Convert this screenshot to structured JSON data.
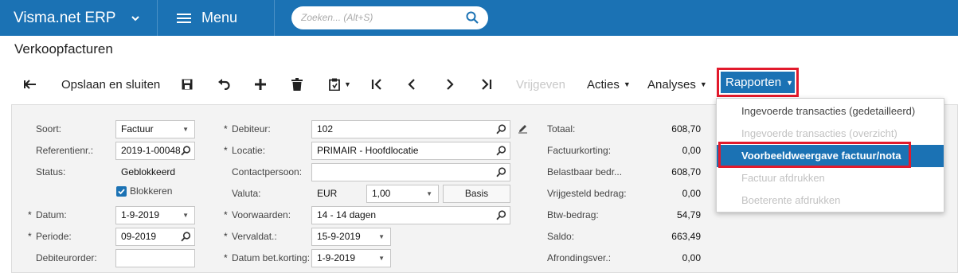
{
  "topbar": {
    "brand": "Visma.net ERP",
    "menu_label": "Menu",
    "search_placeholder": "Zoeken... (Alt+S)"
  },
  "page_title": "Verkoopfacturen",
  "toolbar": {
    "save_close": "Opslaan en sluiten",
    "release": "Vrijgeven",
    "actions": "Acties",
    "analyses": "Analyses",
    "reports": "Rapporten"
  },
  "reports_menu": [
    {
      "label": "Ingevoerde transacties (gedetailleerd)",
      "state": "enabled"
    },
    {
      "label": "Ingevoerde transacties (overzicht)",
      "state": "disabled"
    },
    {
      "label": "Voorbeeldweergave factuur/nota",
      "state": "active"
    },
    {
      "label": "Factuur afdrukken",
      "state": "disabled"
    },
    {
      "label": "Boeterente afdrukken",
      "state": "disabled"
    }
  ],
  "form": {
    "col1": {
      "type_label": "Soort:",
      "type_value": "Factuur",
      "ref_label": "Referentienr.:",
      "ref_value": "2019-1-00048",
      "status_label": "Status:",
      "status_value": "Geblokkeerd",
      "hold_label": "Blokkeren",
      "date_label": "Datum:",
      "date_value": "1-9-2019",
      "period_label": "Periode:",
      "period_value": "09-2019",
      "customer_order_label": "Debiteurorder:",
      "customer_order_value": ""
    },
    "col2": {
      "customer_label": "Debiteur:",
      "customer_value": "102",
      "location_label": "Locatie:",
      "location_value": "PRIMAIR - Hoofdlocatie",
      "contact_label": "Contactpersoon:",
      "contact_value": "",
      "currency_label": "Valuta:",
      "currency_value": "EUR",
      "rate_value": "1,00",
      "basis_label": "Basis",
      "terms_label": "Voorwaarden:",
      "terms_value": "14 - 14 dagen",
      "due_label": "Vervaldat.:",
      "due_value": "15-9-2019",
      "discount_date_label": "Datum bet.korting:",
      "discount_date_value": "1-9-2019"
    },
    "col3": {
      "total_label": "Totaal:",
      "total_value": "608,70",
      "discount_label": "Factuurkorting:",
      "discount_value": "0,00",
      "taxable_label": "Belastbaar bedr...",
      "taxable_value": "608,70",
      "exempt_label": "Vrijgesteld bedrag:",
      "exempt_value": "0,00",
      "vat_label": "Btw-bedrag:",
      "vat_value": "54,79",
      "balance_label": "Saldo:",
      "balance_value": "663,49",
      "rounding_label": "Afrondingsver.:",
      "rounding_value": "0,00"
    }
  },
  "colors": {
    "brand_blue": "#1b72b4",
    "highlight_red": "#e21a2c"
  },
  "icons": [
    "chevron-down-icon",
    "menu-icon",
    "search-icon",
    "back-arrow-icon",
    "save-icon",
    "undo-icon",
    "add-icon",
    "delete-icon",
    "clipboard-icon",
    "first-icon",
    "prev-icon",
    "next-icon",
    "last-icon",
    "lookup-icon",
    "edit-pencil-icon",
    "checkbox-checked-icon"
  ]
}
